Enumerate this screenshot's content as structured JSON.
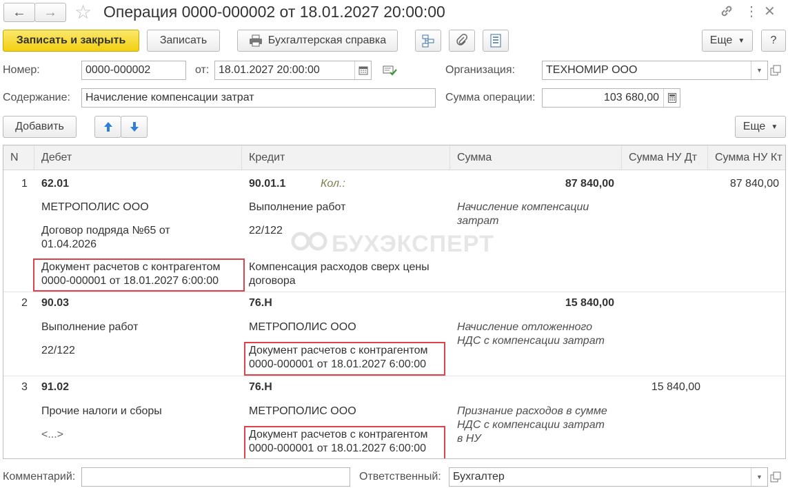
{
  "titlebar": {
    "title": "Операция 0000-000002 от 18.01.2027 20:00:00"
  },
  "toolbar": {
    "save_close": "Записать и закрыть",
    "save": "Записать",
    "report": "Бухгалтерская справка",
    "more": "Еще",
    "help": "?"
  },
  "form": {
    "number_label": "Номер:",
    "number_value": "0000-000002",
    "date_label": "от:",
    "date_value": "18.01.2027 20:00:00",
    "org_label": "Организация:",
    "org_value": "ТЕХНОМИР ООО",
    "content_label": "Содержание:",
    "content_value": "Начисление компенсации затрат",
    "sum_label": "Сумма операции:",
    "sum_value": "103 680,00"
  },
  "table_toolbar": {
    "add": "Добавить",
    "more": "Еще"
  },
  "table": {
    "headers": [
      "N",
      "Дебет",
      "Кредит",
      "Сумма",
      "Сумма НУ Дт",
      "Сумма НУ Кт"
    ],
    "rows": [
      {
        "n": "1",
        "debit": [
          "62.01",
          "МЕТРОПОЛИС ООО",
          "Договор подряда №65 от 01.04.2026",
          "Документ расчетов с контрагентом 0000-000001 от 18.01.2027 6:00:00"
        ],
        "credit": [
          "90.01.1",
          "Выполнение работ",
          "22/122",
          "Компенсация расходов сверх цены договора"
        ],
        "qty_label": "Кол.:",
        "sum": "87 840,00",
        "comment": "Начисление компенсации затрат",
        "nu_dt": "",
        "nu_kt": "87 840,00"
      },
      {
        "n": "2",
        "debit": [
          "90.03",
          "Выполнение работ",
          "22/122"
        ],
        "credit": [
          "76.Н",
          "МЕТРОПОЛИС ООО",
          "Документ расчетов с контрагентом 0000-000001 от 18.01.2027 6:00:00"
        ],
        "sum": "15 840,00",
        "comment": "Начисление отложенного НДС с компенсации затрат",
        "nu_dt": "",
        "nu_kt": ""
      },
      {
        "n": "3",
        "debit": [
          "91.02",
          "Прочие налоги и сборы",
          "<...>"
        ],
        "credit": [
          "76.Н",
          "МЕТРОПОЛИС ООО",
          "Документ расчетов с контрагентом 0000-000001 от 18.01.2027 6:00:00"
        ],
        "sum": "",
        "comment": "Признание расходов в сумме НДС с компенсации затрат в НУ",
        "nu_dt": "15 840,00",
        "nu_kt": ""
      }
    ]
  },
  "watermark": "БУХЭКСПЕРТ",
  "footer": {
    "comment_label": "Комментарий:",
    "comment_value": "",
    "responsible_label": "Ответственный:",
    "responsible_value": "Бухгалтер"
  },
  "icons": [
    "arrow-left-icon",
    "arrow-right-icon",
    "star-icon",
    "link-icon",
    "more-vertical-icon",
    "close-icon",
    "printer-icon",
    "structure-icon",
    "paperclip-icon",
    "list-icon",
    "calendar-icon",
    "check-doc-icon",
    "calculator-icon",
    "open-icon",
    "arrow-up-icon",
    "arrow-down-icon"
  ],
  "colors": {
    "primary_button": "#f2cf11",
    "highlight_frame": "#e0404a",
    "arrow_blue": "#2f7fd6",
    "header_bg": "#f2f2f2"
  }
}
